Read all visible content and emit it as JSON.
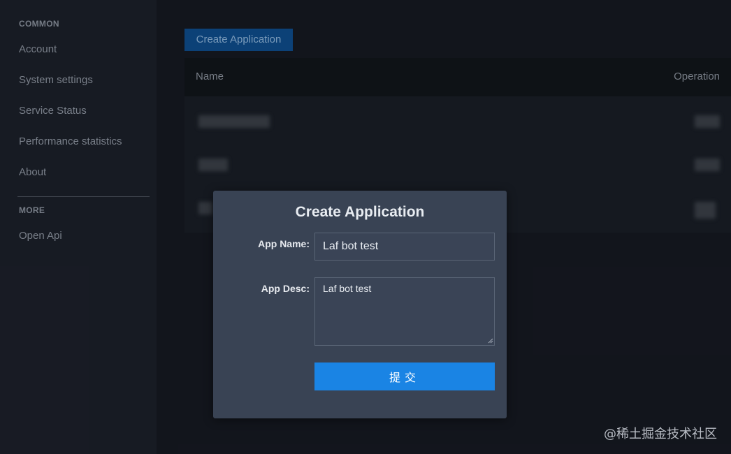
{
  "sidebar": {
    "common_title": "COMMON",
    "common_items": [
      {
        "label": "Account"
      },
      {
        "label": "System settings"
      },
      {
        "label": "Service Status"
      },
      {
        "label": "Performance statistics"
      },
      {
        "label": "About"
      }
    ],
    "more_title": "MORE",
    "more_items": [
      {
        "label": "Open Api"
      }
    ]
  },
  "main": {
    "create_button": "Create Application",
    "table": {
      "columns": {
        "name": "Name",
        "operation": "Operation"
      }
    }
  },
  "modal": {
    "title": "Create Application",
    "name_label": "App Name:",
    "name_value": "Laf bot test",
    "desc_label": "App Desc:",
    "desc_value": "Laf bot test",
    "submit_label": "提交"
  },
  "watermark": "@稀土掘金技术社区",
  "colors": {
    "accent": "#1a84e4",
    "modal_bg": "#394354",
    "page_bg": "#14171f"
  }
}
